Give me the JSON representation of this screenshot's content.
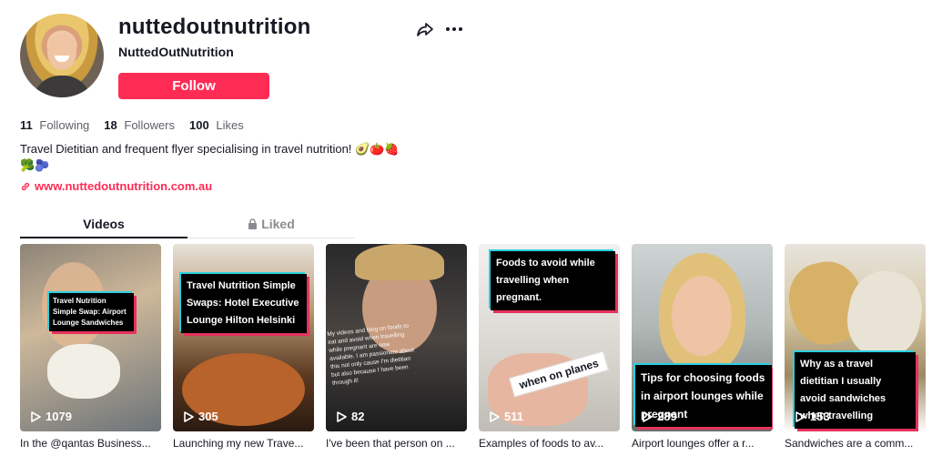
{
  "profile": {
    "username": "nuttedoutnutrition",
    "nickname": "NuttedOutNutrition",
    "follow_label": "Follow",
    "stats": [
      {
        "value": "11",
        "label": "Following"
      },
      {
        "value": "18",
        "label": "Followers"
      },
      {
        "value": "100",
        "label": "Likes"
      }
    ],
    "bio": "Travel Dietitian and frequent flyer specialising in travel nutrition! 🥑🍅🍓",
    "bio_line2": "🥦🫐",
    "link": "www.nuttedoutnutrition.com.au"
  },
  "tabs": {
    "videos": "Videos",
    "liked": "Liked"
  },
  "videos": [
    {
      "views": "1079",
      "caption": "In the @qantas Business...",
      "overlay": "Travel Nutrition Simple Swap: Airport Lounge Sandwiches"
    },
    {
      "views": "305",
      "caption": "Launching my new Trave...",
      "overlay": "Travel Nutrition Simple Swaps: Hotel Executive Lounge Hilton Helsinki"
    },
    {
      "views": "82",
      "caption": "I've been that person on ...",
      "overlay": "My videos and blog on foods to eat and avoid when travelling while pregnant are now available. I am passionate about this not only cause I'm dietitian but also because I have been through it!"
    },
    {
      "views": "511",
      "caption": "Examples of foods to av...",
      "overlay": "Foods to avoid while travelling when pregnant.",
      "overlay2": "when on planes"
    },
    {
      "views": "289",
      "caption": "Airport lounges offer a r...",
      "overlay": "Tips for choosing foods in airport lounges while pregnant"
    },
    {
      "views": "153",
      "caption": "Sandwiches are a comm...",
      "overlay": "Why as a travel dietitian I usually avoid sandwiches when travelling"
    }
  ],
  "colors": {
    "accent": "#fe2c55",
    "text": "#161823",
    "muted": "#5f6068"
  }
}
